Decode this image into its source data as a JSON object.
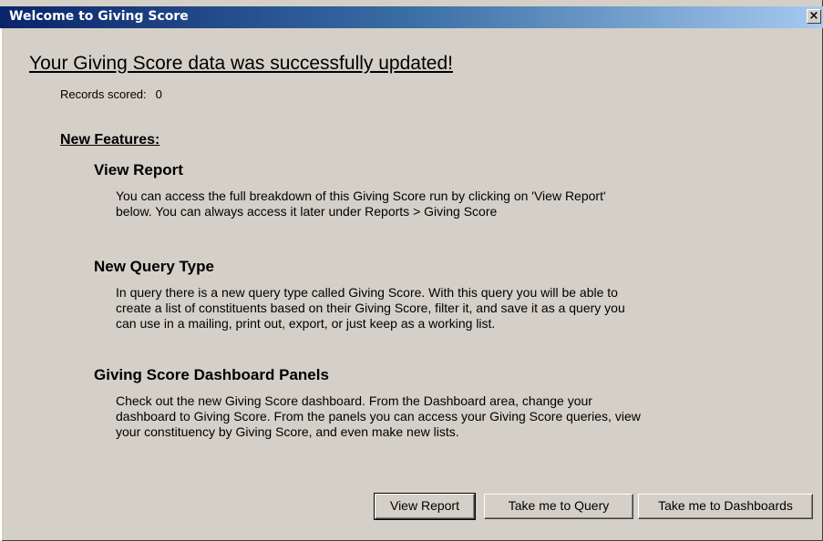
{
  "window": {
    "title": "Welcome to Giving Score",
    "close_glyph": "×"
  },
  "main": {
    "heading": "Your Giving Score data was successfully updated!",
    "records_label": "Records scored:",
    "records_value": "0",
    "new_features_label": "New Features:"
  },
  "features": [
    {
      "title": "View Report",
      "lines": [
        "You can access the full breakdown of this Giving Score run by clicking on 'View Report'",
        "below. You can always access it later under Reports > Giving Score"
      ]
    },
    {
      "title": "New Query Type",
      "lines": [
        "In query there is a new query type called Giving Score.  With this query you will be able to",
        "create a list of constituents based on their Giving Score, filter it, and save it as a query you",
        "can use in a mailing, print out, export, or just keep as a working list."
      ]
    },
    {
      "title": "Giving Score Dashboard Panels",
      "lines": [
        "Check out the new Giving Score dashboard. From the Dashboard area, change your",
        "dashboard to Giving Score.  From the panels you can access your Giving Score queries, view",
        "your constituency by Giving Score, and even make new lists."
      ]
    }
  ],
  "buttons": {
    "view_report": "View Report",
    "take_me_to_query": "Take me to Query",
    "take_me_to_dashboards": "Take me to Dashboards"
  }
}
